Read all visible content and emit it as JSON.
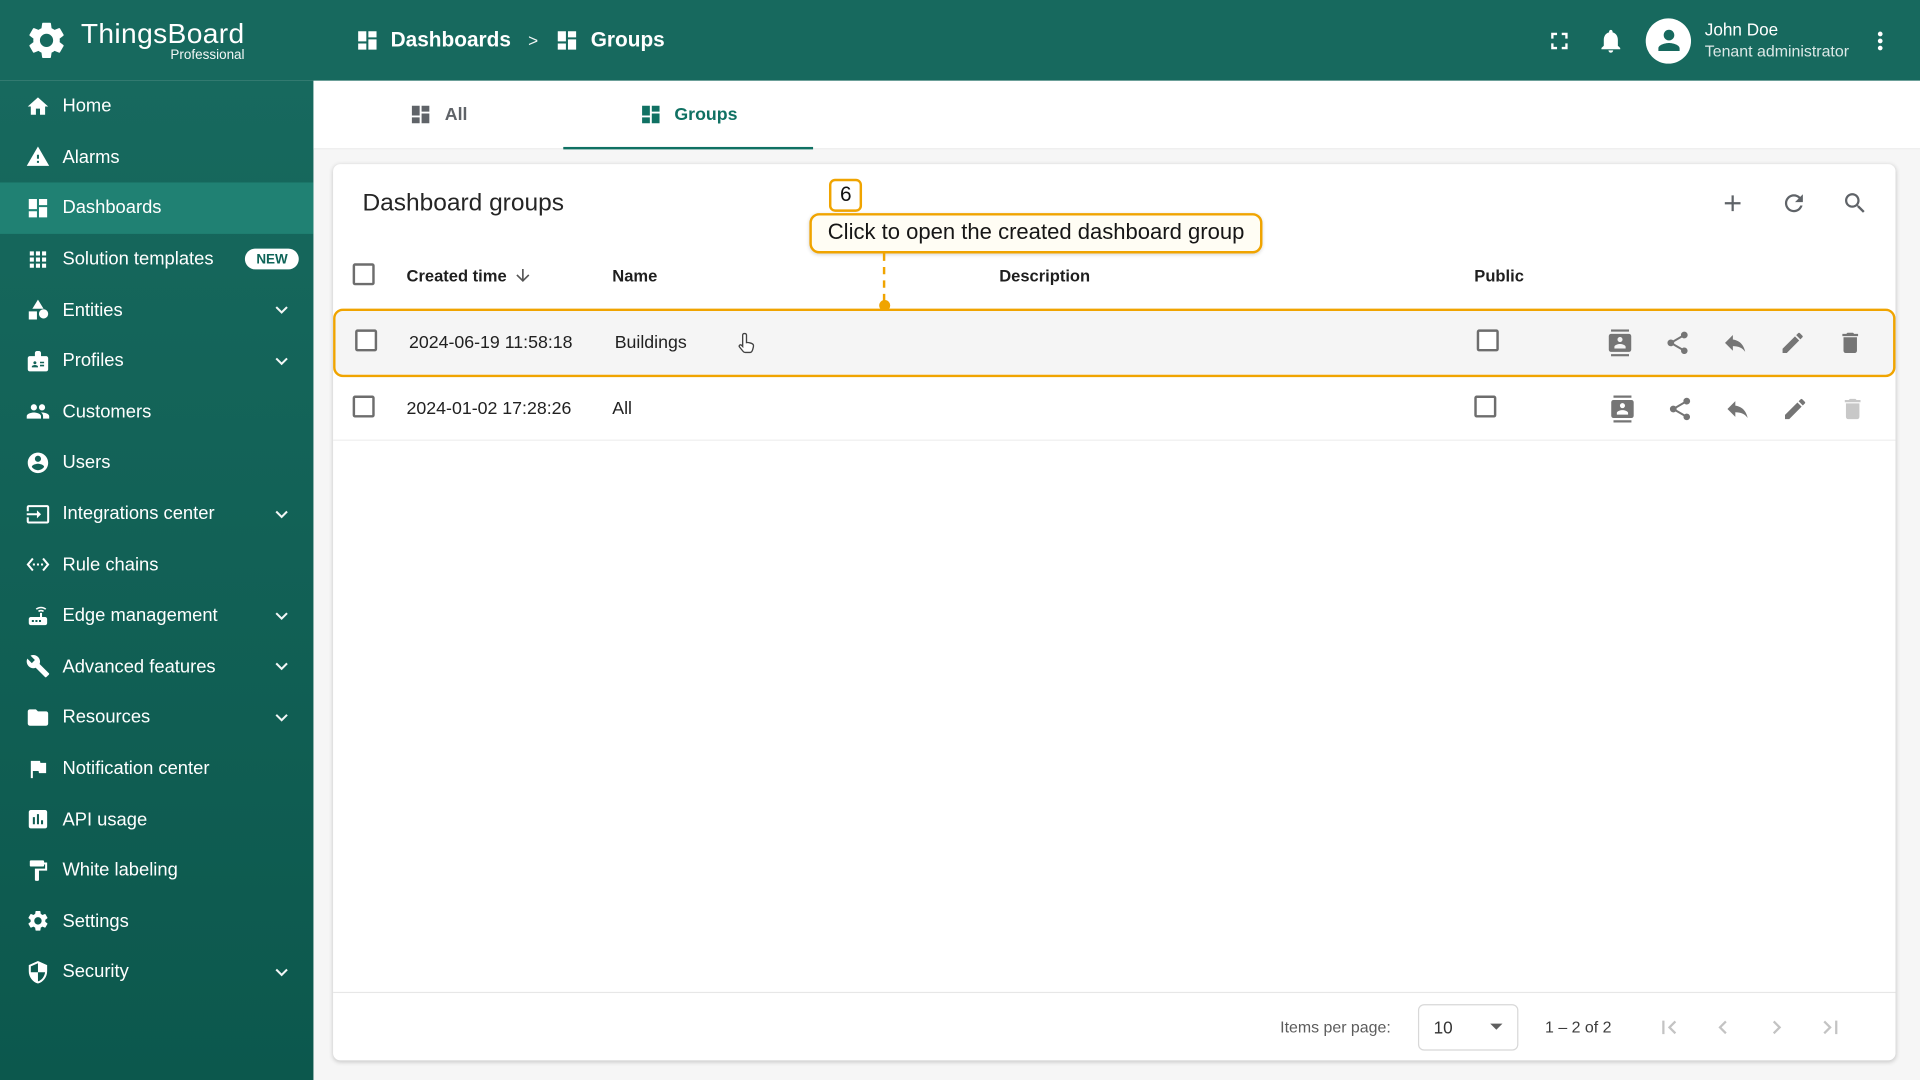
{
  "colors": {
    "primary": "#17695E",
    "sidebar_active": "#208173",
    "tab_active": "#107163",
    "accent": "#F0A400"
  },
  "brand": {
    "title": "ThingsBoard",
    "subtitle": "Professional"
  },
  "header": {
    "breadcrumb": [
      {
        "label": "Dashboards",
        "icon": "dashboard"
      },
      {
        "label": "Groups",
        "icon": "dashboard"
      }
    ],
    "separator": ">",
    "user": {
      "name": "John Doe",
      "role": "Tenant administrator"
    }
  },
  "sidebar": {
    "items": [
      {
        "label": "Home",
        "icon": "home"
      },
      {
        "label": "Alarms",
        "icon": "warning"
      },
      {
        "label": "Dashboards",
        "icon": "dashboard",
        "active": true
      },
      {
        "label": "Solution templates",
        "icon": "apps",
        "badge": "NEW"
      },
      {
        "label": "Entities",
        "icon": "category",
        "expandable": true
      },
      {
        "label": "Profiles",
        "icon": "badge",
        "expandable": true
      },
      {
        "label": "Customers",
        "icon": "people"
      },
      {
        "label": "Users",
        "icon": "person"
      },
      {
        "label": "Integrations center",
        "icon": "input",
        "expandable": true
      },
      {
        "label": "Rule chains",
        "icon": "ethernet"
      },
      {
        "label": "Edge management",
        "icon": "router",
        "expandable": true
      },
      {
        "label": "Advanced features",
        "icon": "build",
        "expandable": true
      },
      {
        "label": "Resources",
        "icon": "folder",
        "expandable": true
      },
      {
        "label": "Notification center",
        "icon": "flag"
      },
      {
        "label": "API usage",
        "icon": "chart"
      },
      {
        "label": "White labeling",
        "icon": "paint"
      },
      {
        "label": "Settings",
        "icon": "settings"
      },
      {
        "label": "Security",
        "icon": "security",
        "expandable": true
      }
    ]
  },
  "tabs": [
    {
      "label": "All",
      "icon": "dashboard",
      "active": false
    },
    {
      "label": "Groups",
      "icon": "dashboard",
      "active": true
    }
  ],
  "page": {
    "card_title": "Dashboard groups",
    "columns": [
      {
        "label": "Created time",
        "sorted": "desc"
      },
      {
        "label": "Name"
      },
      {
        "label": "Description"
      },
      {
        "label": "Public"
      }
    ],
    "rows": [
      {
        "created_time": "2024-06-19 11:58:18",
        "name": "Buildings",
        "description": "",
        "public": false,
        "highlighted": true,
        "deletable": true
      },
      {
        "created_time": "2024-01-02 17:28:26",
        "name": "All",
        "description": "",
        "public": false,
        "highlighted": false,
        "deletable": false
      }
    ],
    "row_actions": [
      {
        "icon": "contacts",
        "name": "manage-group-users"
      },
      {
        "icon": "share",
        "name": "share-group"
      },
      {
        "icon": "reply",
        "name": "unshare-group"
      },
      {
        "icon": "edit",
        "name": "edit-group"
      },
      {
        "icon": "delete",
        "name": "delete-group"
      }
    ]
  },
  "annotation": {
    "step": "6",
    "text": "Click to open the created dashboard group"
  },
  "pagination": {
    "items_per_page_label": "Items per page:",
    "items_per_page": "10",
    "range": "1 – 2 of 2"
  }
}
